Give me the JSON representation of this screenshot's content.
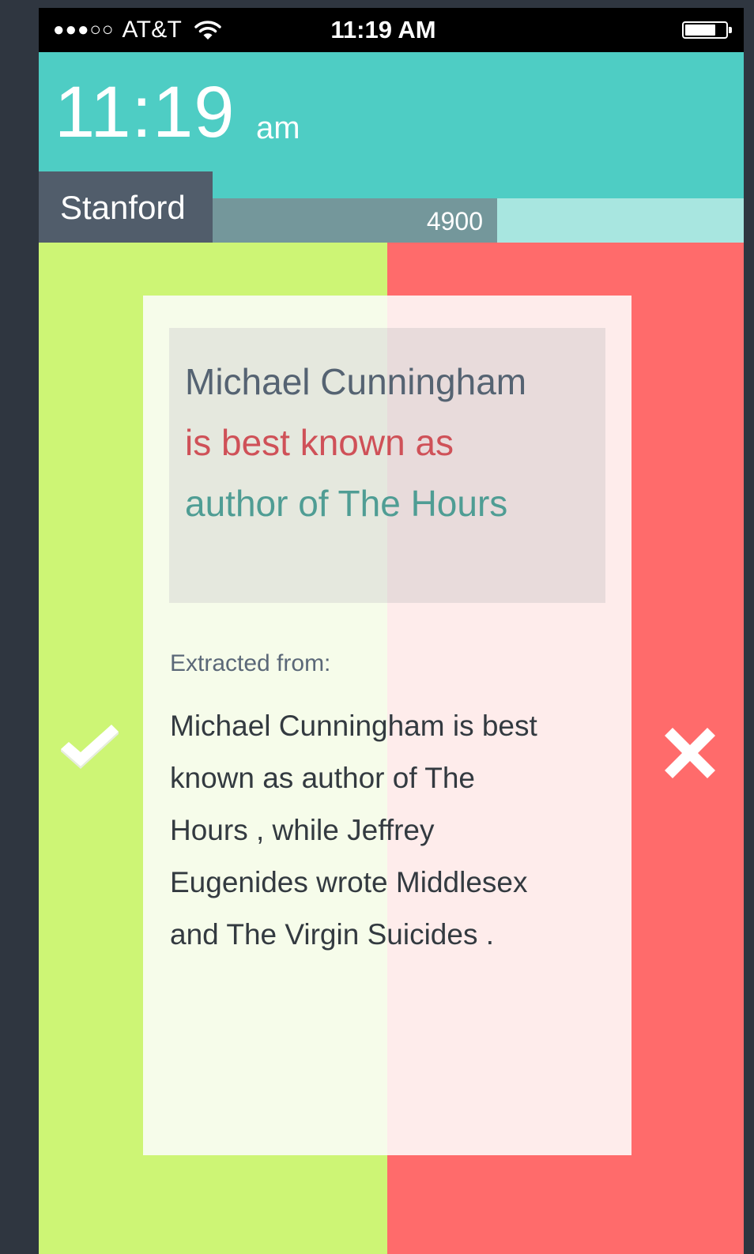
{
  "status_bar": {
    "signal": "●●●○○",
    "carrier": "AT&T",
    "time": "11:19 AM"
  },
  "header": {
    "time": "11:19",
    "ampm": "am"
  },
  "location": "Stanford",
  "score": "4900",
  "progress_fraction": 0.65,
  "card": {
    "fact_lines": [
      "Michael Cunningham",
      "is best known as",
      "author of The Hours"
    ],
    "extracted_label": "Extracted from:",
    "source_lines": [
      "Michael Cunningham is best",
      "known as author of The",
      "Hours , while Jeffrey",
      "Eugenides wrote Middlesex",
      "and The Virgin Suicides ."
    ]
  },
  "colors": {
    "header": "#4ecdc4",
    "accept": "#cdf575",
    "reject": "#ff6b6b",
    "location_bg": "#515d6b",
    "progress": "#74979b"
  },
  "icons": {
    "accept": "check-icon",
    "reject": "x-icon",
    "wifi": "wifi-icon",
    "battery": "battery-icon"
  }
}
